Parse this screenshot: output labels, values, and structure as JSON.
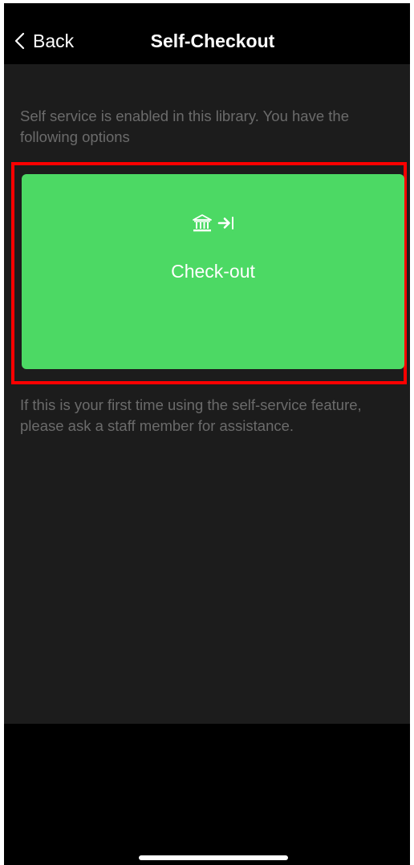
{
  "nav": {
    "back_label": "Back",
    "title": "Self-Checkout"
  },
  "content": {
    "intro": "Self service is enabled in this library. You have the following options",
    "help": "If this is your first time using the self-service feature, please ask a staff member for assistance."
  },
  "checkout_option": {
    "label": "Check-out",
    "icons": [
      "library-building-icon",
      "arrow-right-to-bar-icon"
    ]
  },
  "colors": {
    "background": "#1c1c1c",
    "nav_background": "#000000",
    "card": "#4cd964",
    "highlight": "#ff0000",
    "secondary_text": "#6b6b6b"
  }
}
